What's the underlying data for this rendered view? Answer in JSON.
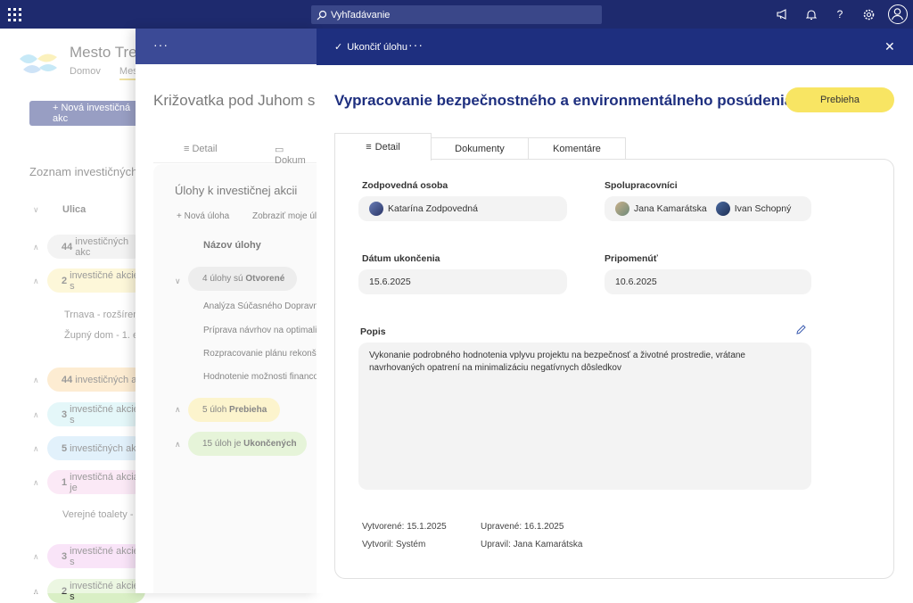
{
  "topbar": {
    "search_placeholder": "Vyhľadávanie",
    "icons": [
      "waffle-icon",
      "megaphone-icon",
      "bell-icon",
      "help-icon",
      "settings-icon",
      "user-icon"
    ]
  },
  "background": {
    "site_title": "Mesto Tre",
    "nav": [
      "Domov",
      "Mest"
    ],
    "new_button": "+ Nová investičná akc",
    "list_title": "Zoznam investičných",
    "column_street": "Ulica",
    "groups": [
      {
        "count": "44",
        "text": "investičných akc",
        "color": "#e6e6e6"
      },
      {
        "count": "2",
        "text": "investičné akcie s",
        "color": "#fbefb3"
      },
      {
        "count": "44",
        "text": "investičných ak",
        "color": "#fbd9a4"
      },
      {
        "count": "3",
        "text": "investičné akcie s",
        "color": "#c9eef3"
      },
      {
        "count": "5",
        "text": "investičných akci",
        "color": "#c4e2f7"
      },
      {
        "count": "1",
        "text": "investičná akcia je",
        "color": "#f7d3ec"
      },
      {
        "count": "3",
        "text": "investičné akcie s",
        "color": "#f3c9f0"
      },
      {
        "count": "2",
        "text": "investičné akcie s",
        "color": "#d9efc5"
      }
    ],
    "rows": [
      "Trnava - rozšírenie",
      "Župný dom - 1. eta",
      "Verejné toalety - plo"
    ]
  },
  "middle": {
    "title": "Križovatka pod Juhom s n",
    "tabs": [
      "Detail",
      "Dokum"
    ],
    "section_title": "Úlohy k investičnej akcii",
    "new_task": "+ Nová úloha",
    "show_mine": "Zobraziť moje úloh",
    "col_task_name": "Názov úlohy",
    "groups": [
      {
        "count": "4",
        "mid": "úlohy sú",
        "status": "Otvorené",
        "color": "#e3e3e3"
      },
      {
        "count": "5",
        "mid": "úloh",
        "status": "Prebieha",
        "color": "#fbefb3"
      },
      {
        "count": "15",
        "mid": "úloh je",
        "status": "Ukončených",
        "color": "#d9efc5"
      }
    ],
    "tasks": [
      "Analýza Súčasného Dopravnéh",
      "Príprava návrhov na optimaliz",
      "Rozpracovanie plánu rekonštru",
      "Hodnotenie možnosti financov"
    ]
  },
  "panel": {
    "complete_task": "Ukončiť úlohu",
    "title": "Vypracovanie bezpečnostného a environmentálneho posúdenia",
    "status": "Prebieha",
    "status_color": "#f8e563",
    "tabs": {
      "detail": "Detail",
      "documents": "Dokumenty",
      "comments": "Komentáre"
    },
    "responsible_label": "Zodpovedná osoba",
    "responsible": "Katarína Zodpovedná",
    "collaborators_label": "Spolupracovníci",
    "collaborators": [
      "Jana Kamarátska",
      "Ivan Schopný"
    ],
    "due_label": "Dátum ukončenia",
    "due": "15.6.2025",
    "reminder_label": "Pripomenúť",
    "reminder": "10.6.2025",
    "description_label": "Popis",
    "description": "Vykonanie podrobného hodnotenia vplyvu projektu na bezpečnosť a životné prostredie, vrátane navrhovaných opatrení na minimalizáciu negatívnych dôsledkov",
    "created": "Vytvorené: 15.1.2025",
    "modified": "Upravené: 16.1.2025",
    "created_by": "Vytvoril: Systém",
    "modified_by": "Upravil: Jana Kamarátska"
  }
}
